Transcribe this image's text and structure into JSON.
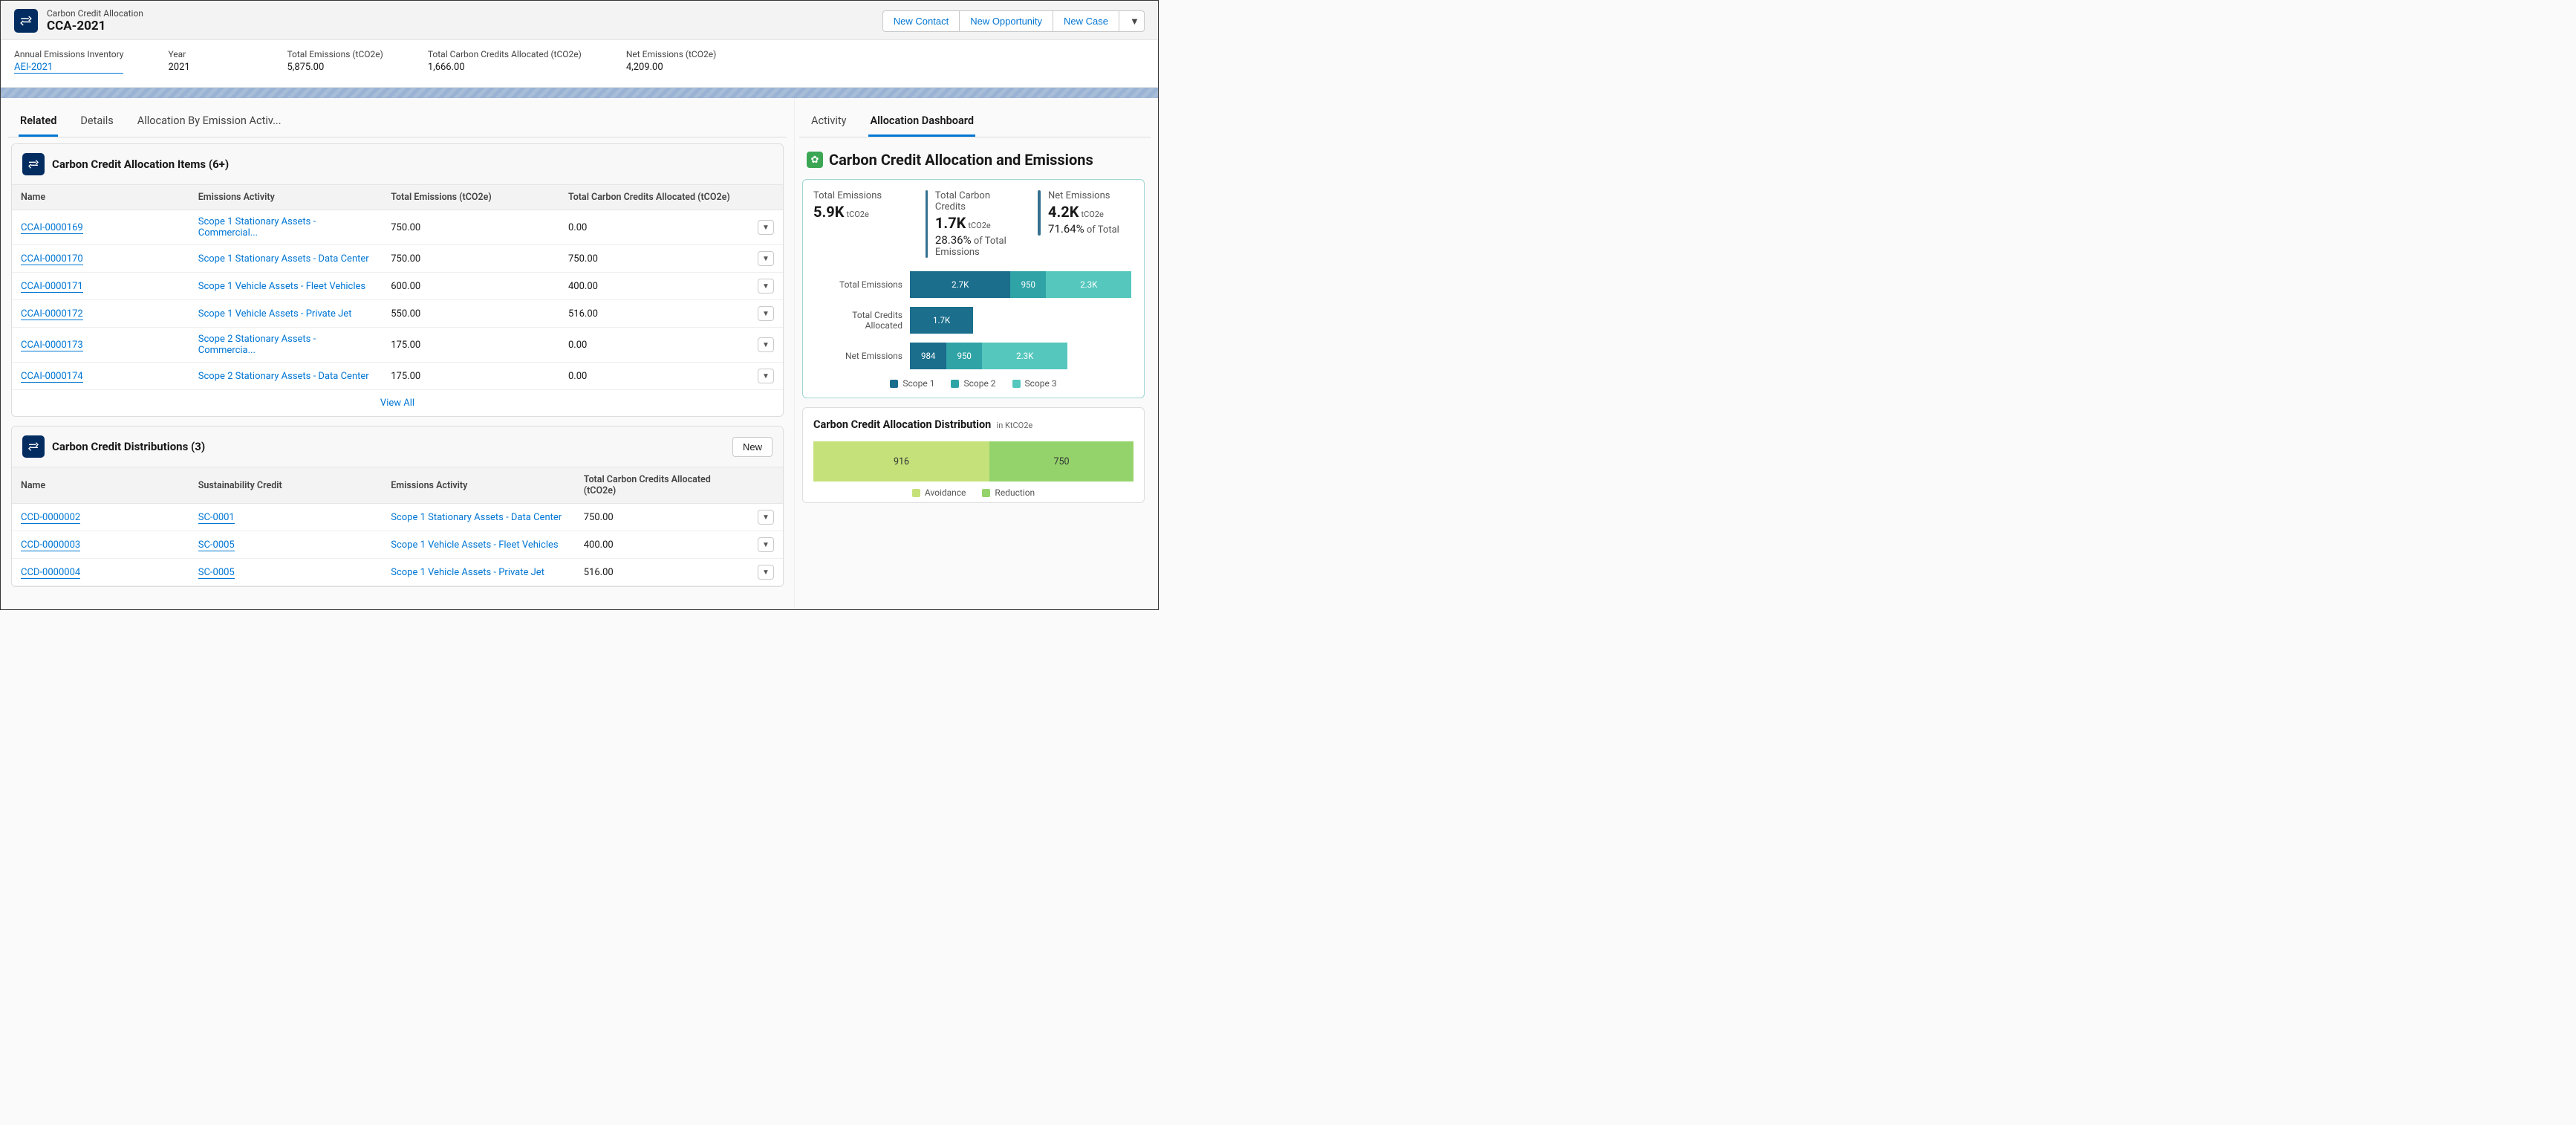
{
  "record": {
    "type_label": "Carbon Credit Allocation",
    "title": "CCA-2021"
  },
  "header_actions": {
    "new_contact": "New Contact",
    "new_opportunity": "New Opportunity",
    "new_case": "New Case"
  },
  "highlights": {
    "aei_label": "Annual Emissions Inventory",
    "aei_link": "AEI-2021",
    "year_label": "Year",
    "year_value": "2021",
    "total_em_label": "Total Emissions (tCO2e)",
    "total_em_value": "5,875.00",
    "total_cc_label": "Total Carbon Credits Allocated (tCO2e)",
    "total_cc_value": "1,666.00",
    "net_em_label": "Net Emissions (tCO2e)",
    "net_em_value": "4,209.00"
  },
  "left_tabs": {
    "related": "Related",
    "details": "Details",
    "allocation": "Allocation By Emission Activ..."
  },
  "items_card": {
    "title": "Carbon Credit Allocation Items (6+)",
    "cols": {
      "c1": "Name",
      "c2": "Emissions Activity",
      "c3": "Total Emissions (tCO2e)",
      "c4": "Total Carbon Credits Allocated (tCO2e)"
    },
    "rows": [
      {
        "name": "CCAI-0000169",
        "activity": "Scope 1 Stationary Assets - Commercial...",
        "total": "750.00",
        "credits": "0.00"
      },
      {
        "name": "CCAI-0000170",
        "activity": "Scope 1 Stationary Assets - Data Center",
        "total": "750.00",
        "credits": "750.00"
      },
      {
        "name": "CCAI-0000171",
        "activity": "Scope 1 Vehicle Assets - Fleet Vehicles",
        "total": "600.00",
        "credits": "400.00"
      },
      {
        "name": "CCAI-0000172",
        "activity": "Scope 1 Vehicle Assets - Private Jet",
        "total": "550.00",
        "credits": "516.00"
      },
      {
        "name": "CCAI-0000173",
        "activity": "Scope 2 Stationary Assets - Commercia...",
        "total": "175.00",
        "credits": "0.00"
      },
      {
        "name": "CCAI-0000174",
        "activity": "Scope 2 Stationary Assets - Data Center",
        "total": "175.00",
        "credits": "0.00"
      }
    ],
    "view_all": "View All"
  },
  "dist_card_list": {
    "title": "Carbon Credit Distributions (3)",
    "new_label": "New",
    "cols": {
      "c1": "Name",
      "c2": "Sustainability Credit",
      "c3": "Emissions Activity",
      "c4": "Total Carbon Credits Allocated (tCO2e)"
    },
    "rows": [
      {
        "name": "CCD-0000002",
        "credit": "SC-0001",
        "activity": "Scope 1 Stationary Assets - Data Center",
        "alloc": "750.00"
      },
      {
        "name": "CCD-0000003",
        "credit": "SC-0005",
        "activity": "Scope 1 Vehicle Assets - Fleet Vehicles",
        "alloc": "400.00"
      },
      {
        "name": "CCD-0000004",
        "credit": "SC-0005",
        "activity": "Scope 1 Vehicle Assets - Private Jet",
        "alloc": "516.00"
      }
    ]
  },
  "right_tabs": {
    "activity": "Activity",
    "dashboard": "Allocation Dashboard"
  },
  "dashboard": {
    "title": "Carbon Credit Allocation and Emissions",
    "stats": {
      "total_em_label": "Total Emissions",
      "total_em_val": "5.9K",
      "unit": "tCO2e",
      "total_cc_label": "Total Carbon Credits",
      "total_cc_val": "1.7K",
      "total_cc_pct": "28.36%",
      "pct_suffix": " of Total Emissions",
      "net_label": "Net Emissions",
      "net_val": "4.2K",
      "net_pct": "71.64%",
      "net_suffix": " of Total"
    },
    "bars": {
      "r1_label": "Total Emissions",
      "r2_label": "Total Credits Allocated",
      "r3_label": "Net Emissions",
      "legend": {
        "s1": "Scope 1",
        "s2": "Scope 2",
        "s3": "Scope 3"
      }
    },
    "dist": {
      "title": "Carbon Credit Allocation Distribution",
      "unit": "in KtCO2e",
      "avoid_label": "Avoidance",
      "reduce_label": "Reduction"
    }
  },
  "chart_data": {
    "stacked_bars": {
      "type": "bar",
      "title": "Carbon Credit Allocation and Emissions",
      "unit": "tCO2e",
      "categories": [
        "Total Emissions",
        "Total Credits Allocated",
        "Net Emissions"
      ],
      "series": [
        {
          "name": "Scope 1",
          "values": [
            2700,
            1700,
            984
          ],
          "color": "#1b6e8c"
        },
        {
          "name": "Scope 2",
          "values": [
            950,
            0,
            950
          ],
          "color": "#2fa3a6"
        },
        {
          "name": "Scope 3",
          "values": [
            2300,
            0,
            2300
          ],
          "color": "#56c7bd"
        }
      ],
      "labels": {
        "Total Emissions": [
          "2.7K",
          "950",
          "2.3K"
        ],
        "Total Credits Allocated": [
          "1.7K"
        ],
        "Net Emissions": [
          "984",
          "950",
          "2.3K"
        ]
      },
      "xmax": 6000
    },
    "distribution": {
      "type": "bar",
      "title": "Carbon Credit Allocation Distribution",
      "unit": "KtCO2e",
      "categories": [
        "Avoidance",
        "Reduction"
      ],
      "values": [
        916,
        750
      ],
      "colors": {
        "Avoidance": "#c5e17a",
        "Reduction": "#94d36b"
      }
    }
  }
}
